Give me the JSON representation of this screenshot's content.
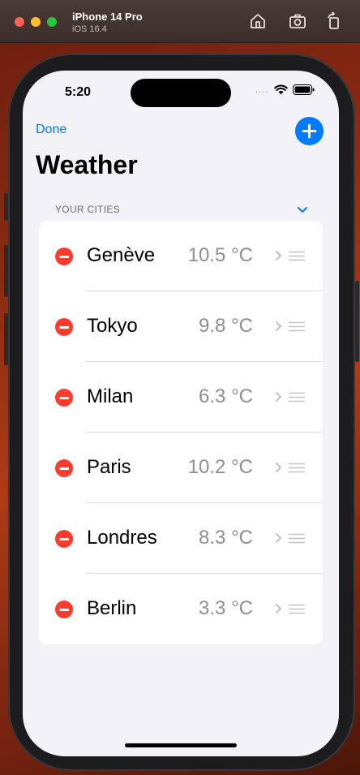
{
  "simulator": {
    "device_name": "iPhone 14 Pro",
    "os_version": "iOS 16.4",
    "buttons": [
      "home-icon",
      "screenshot-icon",
      "rotate-icon"
    ]
  },
  "status_bar": {
    "time": "5:20",
    "signal_dots": "....",
    "icons": [
      "wifi-icon",
      "battery-icon"
    ]
  },
  "nav": {
    "done_label": "Done",
    "add_icon": "plus-icon"
  },
  "page": {
    "title": "Weather"
  },
  "section": {
    "header": "YOUR CITIES",
    "chevron_icon": "chevron-down-icon"
  },
  "cities": [
    {
      "name": "Genève",
      "temp": "10.5 °C"
    },
    {
      "name": "Tokyo",
      "temp": "9.8 °C"
    },
    {
      "name": "Milan",
      "temp": "6.3 °C"
    },
    {
      "name": "Paris",
      "temp": "10.2 °C"
    },
    {
      "name": "Londres",
      "temp": "8.3 °C"
    },
    {
      "name": "Berlin",
      "temp": "3.3 °C"
    }
  ],
  "colors": {
    "accent": "#007aff",
    "delete": "#ff3b30",
    "background": "#f2f2f7",
    "secondary_text": "#8e8e93"
  }
}
